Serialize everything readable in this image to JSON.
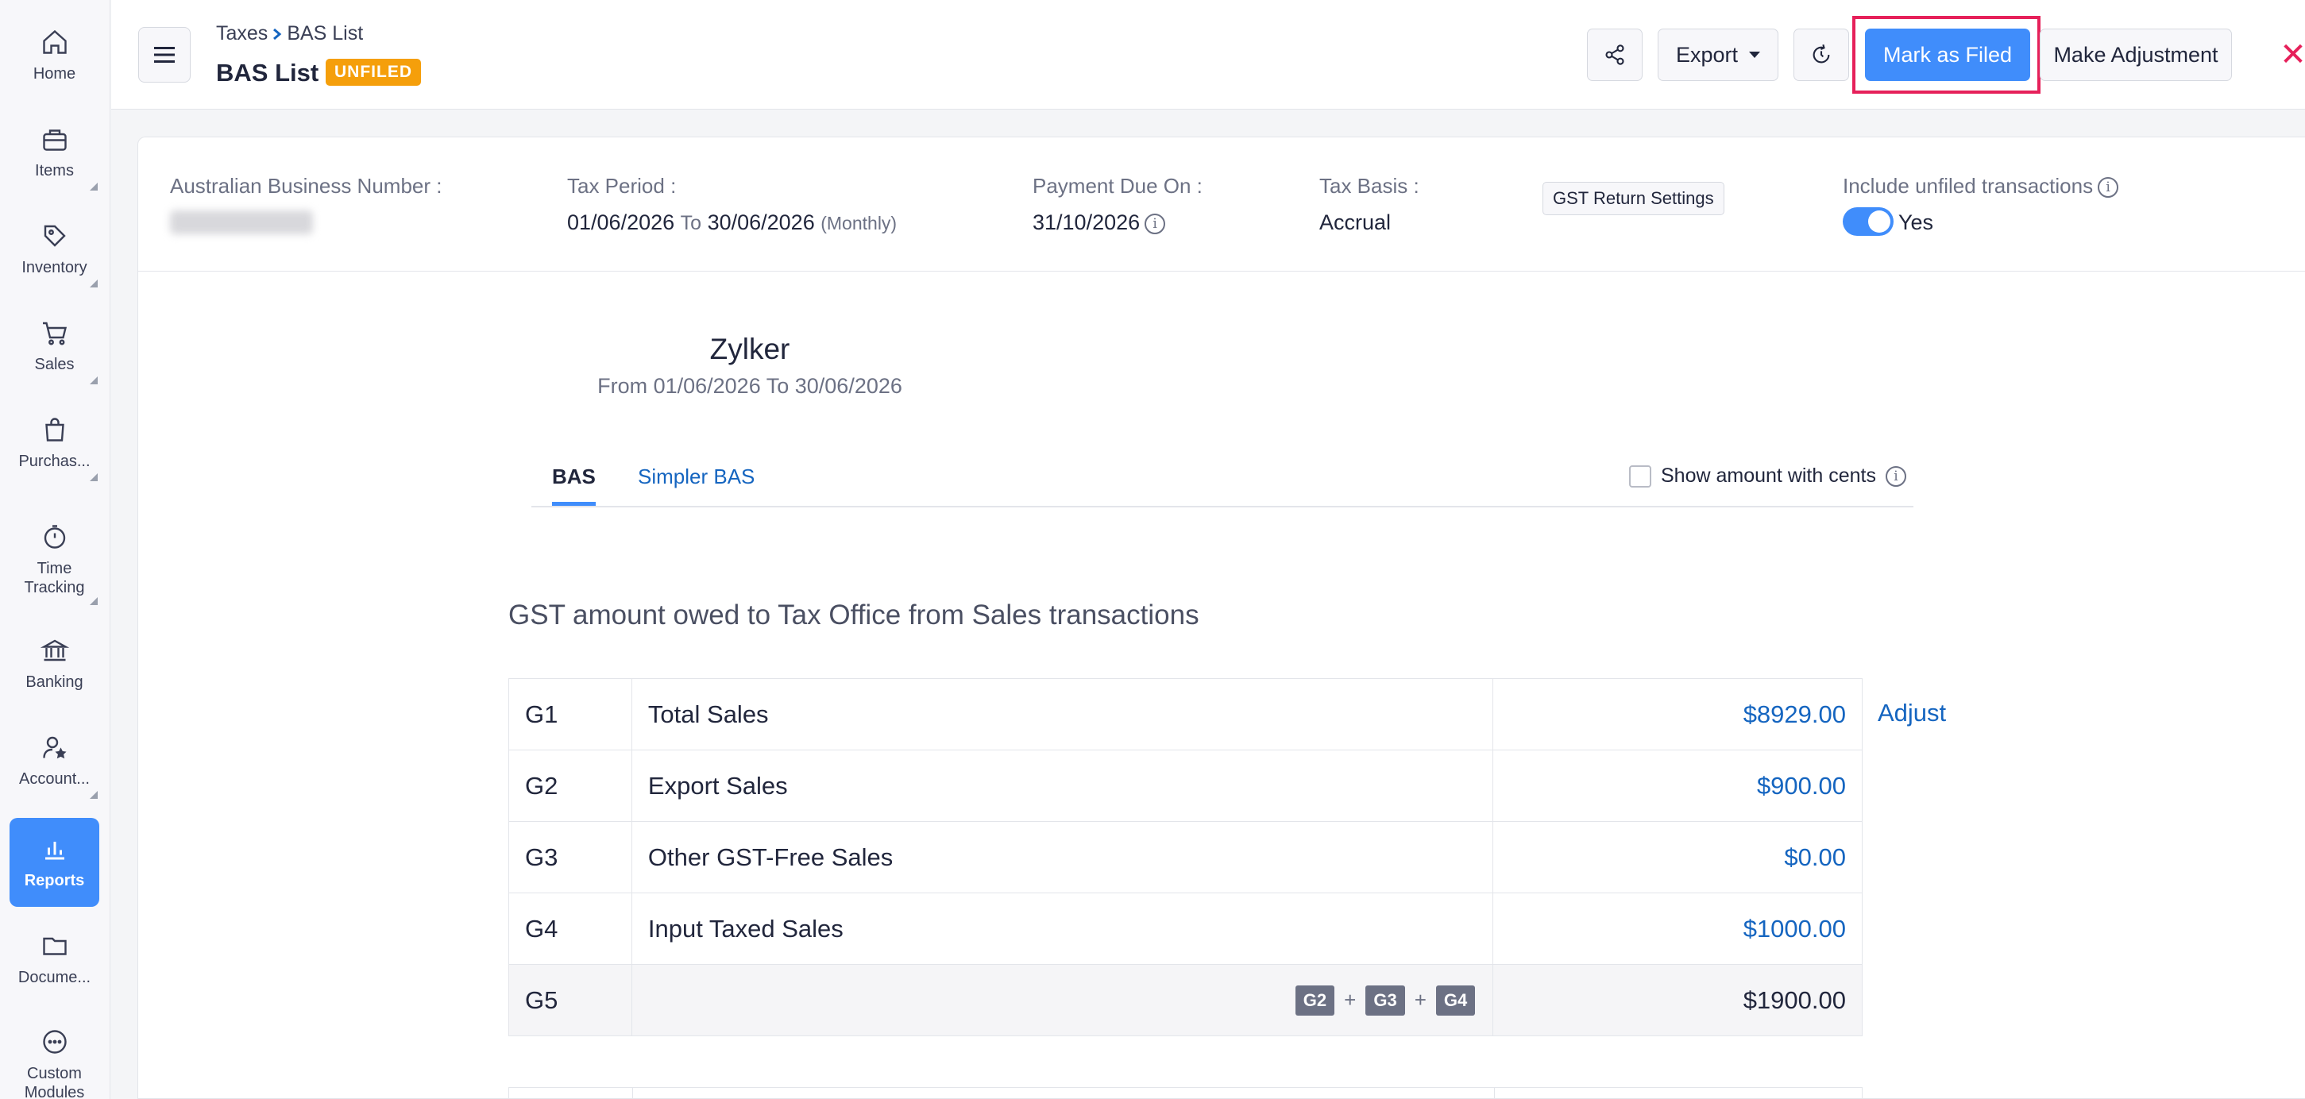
{
  "sidebar": {
    "items": [
      {
        "label": "Home",
        "icon": "home-icon"
      },
      {
        "label": "Items",
        "icon": "items-icon"
      },
      {
        "label": "Inventory",
        "icon": "inventory-icon"
      },
      {
        "label": "Sales",
        "icon": "cart-icon"
      },
      {
        "label": "Purchas...",
        "icon": "bag-icon"
      },
      {
        "label": "Time Tracking",
        "icon": "stopwatch-icon"
      },
      {
        "label": "Banking",
        "icon": "bank-icon"
      },
      {
        "label": "Account...",
        "icon": "accountant-icon"
      },
      {
        "label": "Reports",
        "icon": "reports-icon"
      },
      {
        "label": "Docume...",
        "icon": "folder-icon"
      },
      {
        "label": "Custom Modules",
        "icon": "more-icon"
      }
    ]
  },
  "header": {
    "breadcrumb_parent": "Taxes",
    "breadcrumb_current": "BAS List",
    "title": "BAS List",
    "status": "UNFILED",
    "export_label": "Export",
    "mark_filed_label": "Mark as Filed",
    "make_adjustment_label": "Make Adjustment",
    "close_symbol": "✕"
  },
  "info": {
    "abn_label": "Australian Business Number :",
    "tax_period_label": "Tax Period :",
    "tax_period_from": "01/06/2026",
    "tax_period_to_word": "To",
    "tax_period_to": "30/06/2026",
    "tax_period_freq": "(Monthly)",
    "payment_due_label": "Payment Due On :",
    "payment_due_value": "31/10/2026",
    "tax_basis_label": "Tax Basis :",
    "tax_basis_value": "Accrual",
    "gst_settings_label": "GST Return Settings",
    "include_unfiled_label": "Include unfiled transactions",
    "include_unfiled_value": "Yes"
  },
  "report": {
    "company": "Zylker",
    "period": "From 01/06/2026  To 30/06/2026",
    "tab_bas": "BAS",
    "tab_simpler": "Simpler BAS",
    "show_cents_label": "Show amount with cents",
    "section_title": "GST amount owed to Tax Office from Sales transactions",
    "adjust_label": "Adjust",
    "rows": [
      {
        "code": "G1",
        "desc": "Total Sales",
        "amount": "$8929.00"
      },
      {
        "code": "G2",
        "desc": "Export Sales",
        "amount": "$900.00"
      },
      {
        "code": "G3",
        "desc": "Other GST-Free Sales",
        "amount": "$0.00"
      },
      {
        "code": "G4",
        "desc": "Input Taxed Sales",
        "amount": "$1000.00"
      }
    ],
    "total": {
      "code": "G5",
      "chips": [
        "G2",
        "G3",
        "G4"
      ],
      "plus": "+",
      "amount": "$1900.00"
    }
  },
  "colors": {
    "accent": "#408dfb",
    "status_badge": "#f59f0b",
    "highlight": "#e6205a",
    "link": "#1565c0"
  }
}
